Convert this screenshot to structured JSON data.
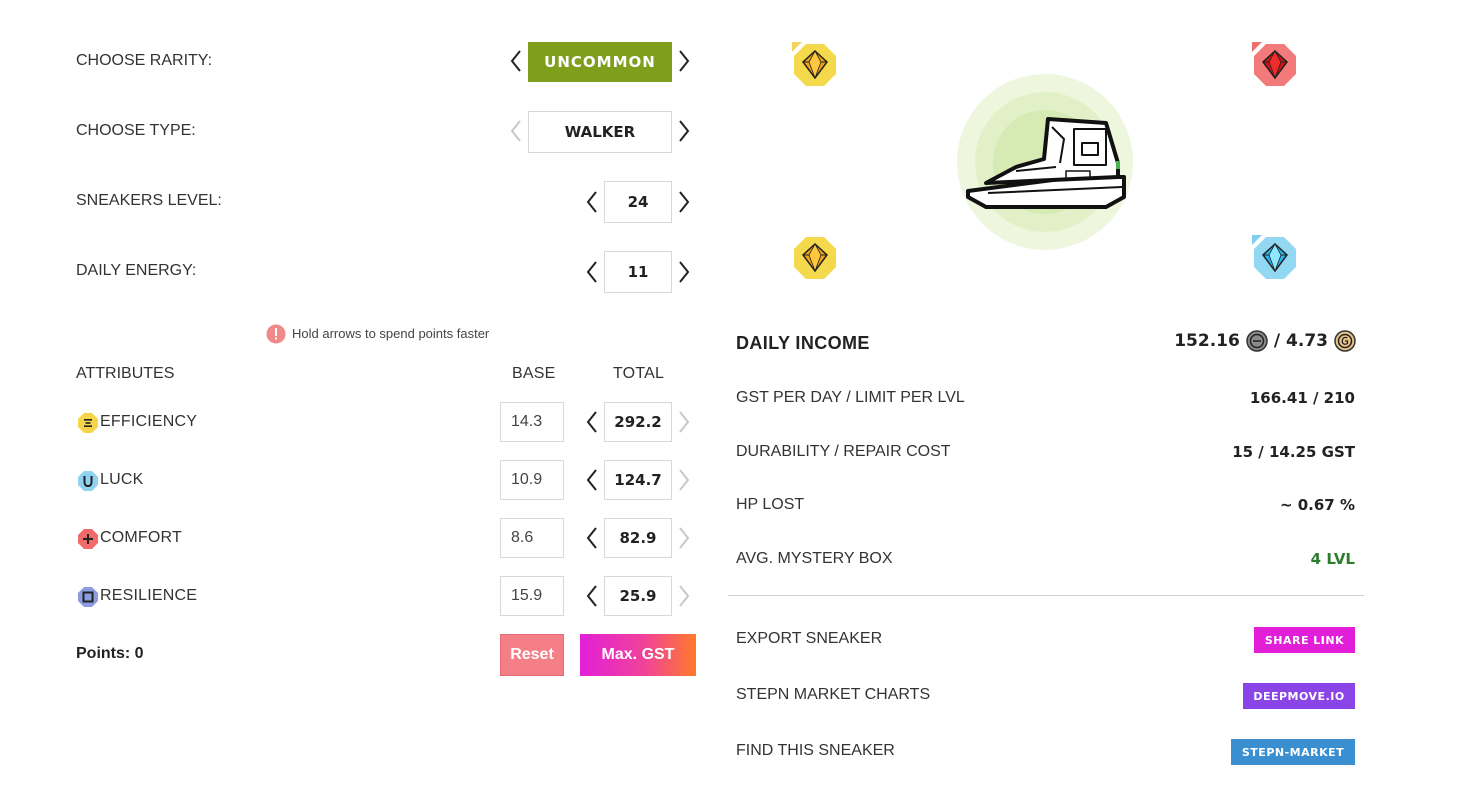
{
  "selectors": {
    "rarity": {
      "label": "CHOOSE RARITY:",
      "value": "UNCOMMON"
    },
    "type": {
      "label": "CHOOSE TYPE:",
      "value": "WALKER"
    },
    "level": {
      "label": "SNEAKERS LEVEL:",
      "value": "24"
    },
    "energy": {
      "label": "DAILY ENERGY:",
      "value": "11"
    }
  },
  "hint": "Hold arrows to spend points faster",
  "attributes": {
    "header": "ATTRIBUTES",
    "base_header": "BASE",
    "total_header": "TOTAL",
    "items": [
      {
        "name": "EFFICIENCY",
        "base": "14.3",
        "total": "292.2",
        "icon": "efficiency-icon",
        "color": "#f7d54a"
      },
      {
        "name": "LUCK",
        "base": "10.9",
        "total": "124.7",
        "icon": "luck-icon",
        "color": "#8fd3f0"
      },
      {
        "name": "COMFORT",
        "base": "8.6",
        "total": "82.9",
        "icon": "comfort-icon",
        "color": "#f26b6b"
      },
      {
        "name": "RESILIENCE",
        "base": "15.9",
        "total": "25.9",
        "icon": "resilience-icon",
        "color": "#8b9de0"
      }
    ]
  },
  "points": {
    "label": "Points:",
    "value": "0"
  },
  "buttons": {
    "reset": "Reset",
    "max_gst": "Max. GST"
  },
  "income": {
    "title": "DAILY INCOME",
    "gst": "152.16",
    "sep": "/",
    "gmt": "4.73",
    "rows": [
      {
        "label": "GST PER DAY / LIMIT PER LVL",
        "value": "166.41 / 210"
      },
      {
        "label": "DURABILITY / REPAIR COST",
        "value": "15 / 14.25 GST"
      },
      {
        "label": "HP LOST",
        "value": "~ 0.67 %"
      },
      {
        "label": "AVG. MYSTERY BOX",
        "value": "4 LVL"
      }
    ]
  },
  "links": [
    {
      "label": "EXPORT SNEAKER",
      "button": "SHARE LINK",
      "color": "#e21fd8"
    },
    {
      "label": "STEPN MARKET CHARTS",
      "button": "DEEPMOVE.IO",
      "color": "#8b45e6"
    },
    {
      "label": "FIND THIS SNEAKER",
      "button": "STEPN-MARKET",
      "color": "#3a8fd0"
    }
  ],
  "colors": {
    "rarity_accent": "#7f9e1c",
    "mystery_box_green": "#2e7d2e",
    "reset": "#f47f86",
    "max_gst_gradient": [
      "#e21fd8",
      "#ff7a2a"
    ]
  }
}
